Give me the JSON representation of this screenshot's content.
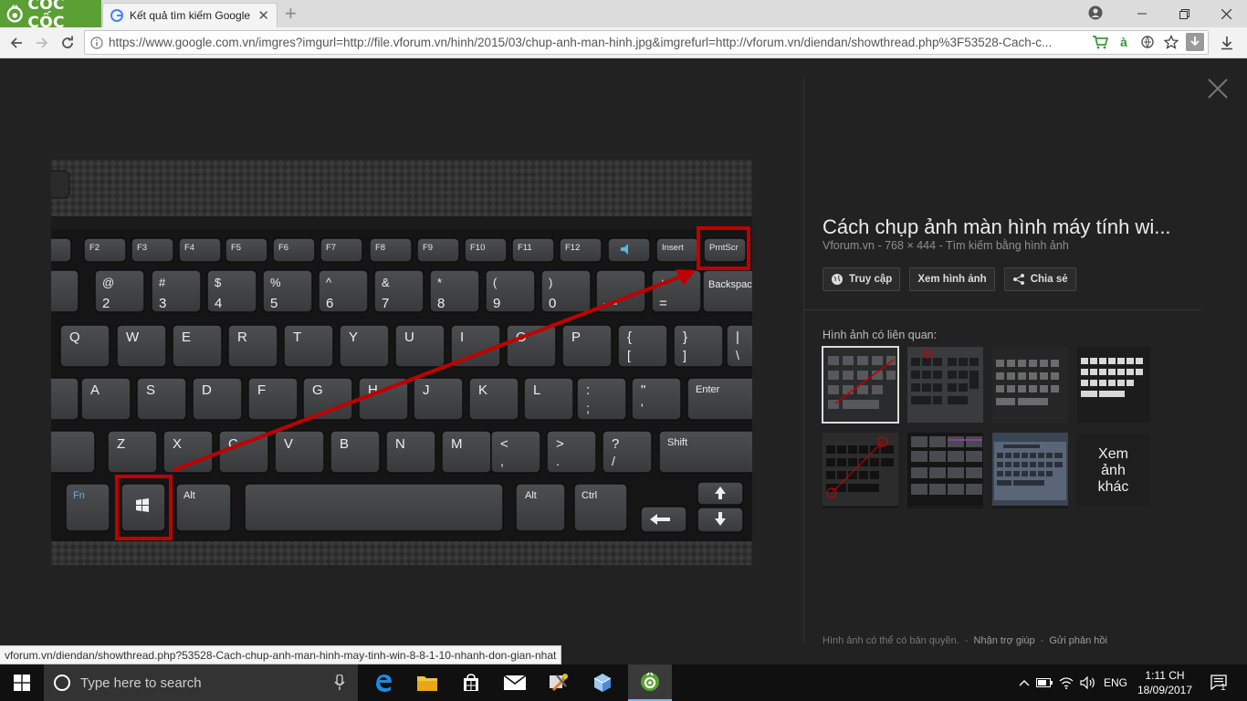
{
  "browser": {
    "brand_name": "CỐC CỐC",
    "tab_title": "Kết quả tìm kiếm Google c",
    "url": "https://www.google.com.vn/imgres?imgurl=http://file.vforum.vn/hinh/2015/03/chup-anh-man-hinh.jpg&imgrefurl=http://vforum.vn/diendan/showthread.php%3F53528-Cach-c...",
    "vi_icon_label": "à"
  },
  "panel": {
    "title": "Cách chụp ảnh màn hình máy tính wi...",
    "source": "Vforum.vn",
    "dimensions": "768 × 444",
    "search_by_image": "Tìm kiếm bằng hình ảnh",
    "sep": "-",
    "buttons": {
      "visit": "Truy cập",
      "view_image": "Xem hình ảnh",
      "share": "Chia sẻ"
    },
    "related_label": "Hình ảnh có liên quan:",
    "more_images": [
      "Xem",
      "ảnh",
      "khác"
    ],
    "footer": {
      "copyright": "Hình ảnh có thể có bản quyền.",
      "help": "Nhận trợ giúp",
      "feedback": "Gửi phản hồi"
    }
  },
  "keyboard": {
    "frow": [
      "F2",
      "F3",
      "F4",
      "F5",
      "F6",
      "F7",
      "F8",
      "F9",
      "F10",
      "F11",
      "F12",
      "",
      "Insert",
      "PrntScr"
    ],
    "num_top": [
      "@",
      "#",
      "$",
      "%",
      "^",
      "&",
      "*",
      "(",
      ")",
      "",
      "+"
    ],
    "num_bottom": [
      "2",
      "3",
      "4",
      "5",
      "6",
      "7",
      "8",
      "9",
      "0",
      "—",
      "="
    ],
    "backspace": "Backspac",
    "qrow": [
      "Q",
      "W",
      "E",
      "R",
      "T",
      "Y",
      "U",
      "I",
      "O",
      "P",
      "{",
      "}",
      "|"
    ],
    "qrow_bottom": [
      "",
      "",
      "",
      "",
      "",
      "",
      "",
      "",
      "",
      "",
      "[",
      "]",
      "\\"
    ],
    "arow": [
      "A",
      "S",
      "D",
      "F",
      "G",
      "H",
      "J",
      "K",
      "L",
      ":",
      "\""
    ],
    "arow_bottom": [
      "",
      "",
      "",
      "",
      "",
      "",
      "",
      "",
      "",
      ";",
      "'"
    ],
    "enter": "Enter",
    "zrow": [
      "Z",
      "X",
      "C",
      "V",
      "B",
      "N",
      "M",
      "<",
      ">",
      "?"
    ],
    "zrow_bottom": [
      "",
      "",
      "",
      "",
      "",
      "",
      "",
      ",",
      ".",
      "/"
    ],
    "shift": "Shift",
    "fn": "Fn",
    "alt": "Alt",
    "ctrl": "Ctrl"
  },
  "status_url": "vforum.vn/diendan/showthread.php?53528-Cach-chup-anh-man-hinh-may-tinh-win-8-8-1-10-nhanh-don-gian-nhat",
  "taskbar": {
    "search_placeholder": "Type here to search",
    "language": "ENG",
    "time": "1:11 CH",
    "date": "18/09/2017",
    "notification_count": "1"
  },
  "colors": {
    "accent_red": "#c00000",
    "coccoc_green": "#5aa034"
  }
}
